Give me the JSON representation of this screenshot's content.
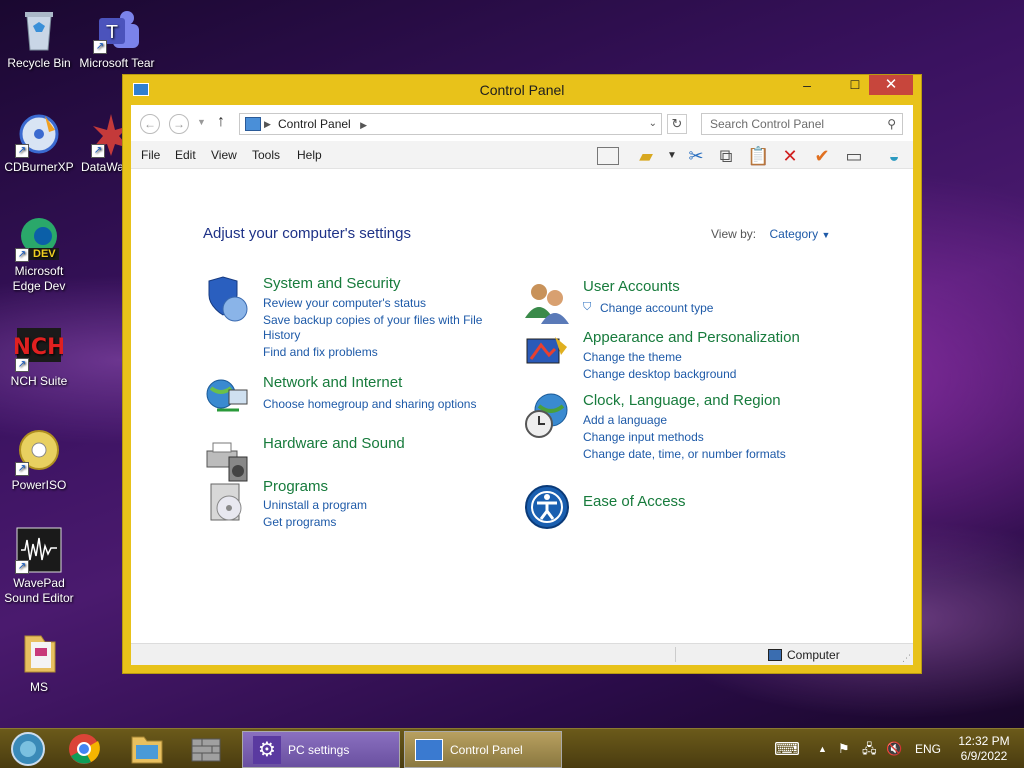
{
  "desktop": {
    "icons": [
      {
        "label": "Recycle Bin"
      },
      {
        "label": "Microsoft Tear"
      },
      {
        "label": "CDBurnerXP"
      },
      {
        "label": "DataWa"
      },
      {
        "label": "Microsoft Edge Dev",
        "badge": "DEV"
      },
      {
        "label": "NCH Suite"
      },
      {
        "label": "PowerISO"
      },
      {
        "label": "WavePad Sound Editor"
      },
      {
        "label": "MS"
      }
    ]
  },
  "window": {
    "title": "Control Panel",
    "address": {
      "location": "Control Panel",
      "search_placeholder": "Search Control Panel"
    },
    "menu": [
      "File",
      "Edit",
      "View",
      "Tools",
      "Help"
    ],
    "heading": "Adjust your computer's settings",
    "view_by": {
      "label": "View by:",
      "value": "Category"
    },
    "categories_left": [
      {
        "title": "System and Security",
        "links": [
          "Review your computer's status",
          "Save backup copies of your files with File",
          "History",
          "Find and fix problems"
        ]
      },
      {
        "title": "Network and Internet",
        "links": [
          "Choose homegroup and sharing options"
        ]
      },
      {
        "title": "Hardware and Sound",
        "links": []
      },
      {
        "title": "Programs",
        "links": [
          "Uninstall a program",
          "Get programs"
        ]
      }
    ],
    "categories_right": [
      {
        "title": "User Accounts",
        "links": [
          "Change account type"
        ]
      },
      {
        "title": "Appearance and Personalization",
        "links": [
          "Change the theme",
          "Change desktop background"
        ]
      },
      {
        "title": "Clock, Language, and Region",
        "links": [
          "Add a language",
          "Change input methods",
          "Change date, time, or number formats"
        ]
      },
      {
        "title": "Ease of Access",
        "links": []
      }
    ],
    "status": "Computer"
  },
  "taskbar": {
    "tasks": [
      "PC settings",
      "Control Panel"
    ],
    "language": "ENG",
    "time": "12:32 PM",
    "date": "6/9/2022"
  },
  "colors": {
    "window_frame": "#e8c21a",
    "link": "#1e5aa8",
    "category_title": "#177b3c",
    "close": "#c7463c"
  }
}
